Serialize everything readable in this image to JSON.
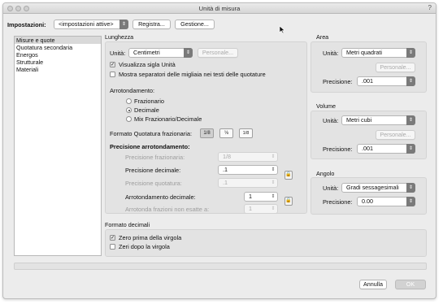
{
  "window": {
    "title": "Unità di misura",
    "help": "?"
  },
  "top": {
    "impostazioni_label": "Impostazioni:",
    "impostazioni_value": "<impostazioni attive>",
    "registra": "Registra...",
    "gestione": "Gestione..."
  },
  "sidebar": {
    "items": [
      {
        "label": "Misure e quote",
        "selected": true
      },
      {
        "label": "Quotatura secondaria"
      },
      {
        "label": "Energos"
      },
      {
        "label": "Strutturale"
      },
      {
        "label": "Materiali"
      }
    ]
  },
  "lunghezza": {
    "title": "Lunghezza",
    "unita_label": "Unità:",
    "unita_value": "Centimetri",
    "personale": "Personale...",
    "visualizza": "Visualizza sigla Unità",
    "visualizza_checked": true,
    "mostra": "Mostra separatori delle migliaia nei testi delle quotature",
    "mostra_checked": false,
    "arrotondamento_title": "Arrotondamento:",
    "radios": [
      "Frazionario",
      "Decimale",
      "Mix Frazionario/Decimale"
    ],
    "radio_selected": "Decimale",
    "formato_label": "Formato Quotatura frazionaria:",
    "formato_buttons": [
      "1/8",
      "⅛",
      "1/8"
    ],
    "precisione_title": "Precisione arrotondamento:",
    "prec_frazionaria_label": "Precisione frazionaria:",
    "prec_frazionaria_value": "1/8",
    "prec_decimale_label": "Precisione decimale:",
    "prec_decimale_value": ".1",
    "prec_quotatura_label": "Precisione quotatura:",
    "prec_quotatura_value": ".1",
    "arr_decimale_label": "Arrotondamento decimale:",
    "arr_decimale_value": "1",
    "arr_frazioni_label": "Arrotonda frazioni non esatte a:",
    "arr_frazioni_value": "1"
  },
  "area": {
    "title": "Area",
    "unita_label": "Unità:",
    "unita_value": "Metri quadrati",
    "personale": "Personale...",
    "precisione_label": "Precisione:",
    "precisione_value": ".001"
  },
  "volume": {
    "title": "Volume",
    "unita_label": "Unità:",
    "unita_value": "Metri cubi",
    "personale": "Personale...",
    "precisione_label": "Precisione:",
    "precisione_value": ".001"
  },
  "angolo": {
    "title": "Angolo",
    "unita_label": "Unità:",
    "unita_value": "Gradi sessagesimali",
    "precisione_label": "Precisione:",
    "precisione_value": "0.00"
  },
  "decimali": {
    "title": "Formato decimali",
    "zero_prima": "Zero prima della virgola",
    "zero_prima_checked": true,
    "zeri_dopo": "Zeri dopo la virgola",
    "zeri_dopo_checked": false
  },
  "footer": {
    "annulla": "Annulla",
    "ok": "OK"
  },
  "icons": {
    "dropdown": "⇕",
    "stepper": "⇕",
    "lock": "lock-icon"
  }
}
